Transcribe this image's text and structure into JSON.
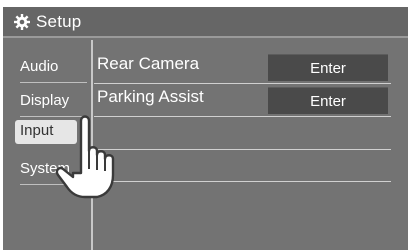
{
  "header": {
    "title": "Setup",
    "icon": "gear-icon"
  },
  "sidebar": {
    "items": [
      {
        "label": "Audio"
      },
      {
        "label": "Display"
      },
      {
        "label": "Input",
        "selected": true
      },
      {
        "label": "System"
      }
    ]
  },
  "main": {
    "rows": [
      {
        "label": "Rear Camera",
        "button": "Enter"
      },
      {
        "label": "Parking Assist",
        "button": "Enter"
      }
    ]
  },
  "overlay": {
    "icon": "pointing-hand-icon"
  }
}
